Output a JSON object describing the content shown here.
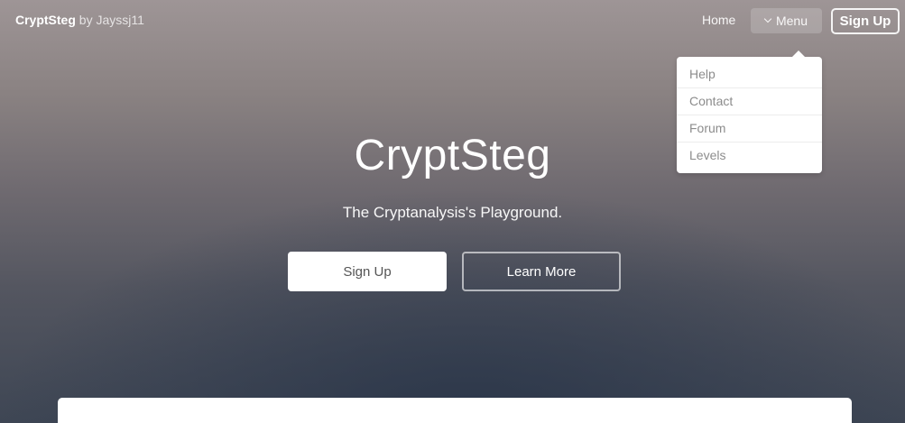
{
  "header": {
    "brand_name": "CryptSteg",
    "brand_by": " by Jayssj11",
    "nav": {
      "home_label": "Home",
      "menu_label": "Menu",
      "signup_label": "Sign Up"
    }
  },
  "dropdown": {
    "items": [
      {
        "label": "Help"
      },
      {
        "label": "Contact"
      },
      {
        "label": "Forum"
      },
      {
        "label": "Levels"
      }
    ]
  },
  "hero": {
    "title": "CryptSteg",
    "subtitle": "The Cryptanalysis's Playground.",
    "primary_button": "Sign Up",
    "secondary_button": "Learn More"
  },
  "colors": {
    "background_top": "#9e9596",
    "background_bottom": "#3e4654",
    "accent": "#ffffff"
  },
  "icons": {
    "menu_toggle": "chevron-down-icon"
  }
}
